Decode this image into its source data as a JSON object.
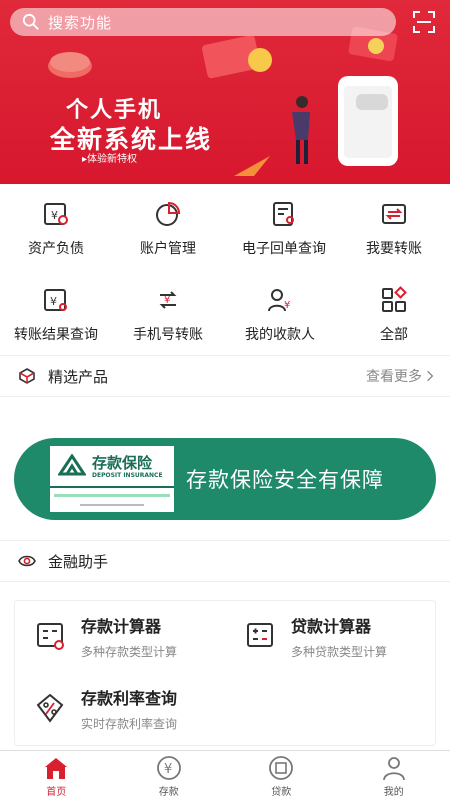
{
  "search": {
    "placeholder": "搜索功能"
  },
  "banner": {
    "line1": "个人手机",
    "line2": "全新系统上线",
    "tag": "▸体验新特权"
  },
  "quick_actions": [
    {
      "label": "资产负债",
      "icon": "asset-liability-icon"
    },
    {
      "label": "账户管理",
      "icon": "pie-chart-icon"
    },
    {
      "label": "电子回单查询",
      "icon": "receipt-search-icon"
    },
    {
      "label": "我要转账",
      "icon": "transfer-icon"
    },
    {
      "label": "转账结果查询",
      "icon": "transfer-result-icon"
    },
    {
      "label": "手机号转账",
      "icon": "phone-transfer-icon"
    },
    {
      "label": "我的收款人",
      "icon": "payee-icon"
    },
    {
      "label": "全部",
      "icon": "all-apps-icon"
    }
  ],
  "featured": {
    "title": "精选产品",
    "more": "查看更多"
  },
  "insurance": {
    "card_title": "存款保险",
    "card_subtitle": "DEPOSIT INSURANCE",
    "slogan": "存款保险安全有保障"
  },
  "assistant": {
    "title": "金融助手"
  },
  "tools": [
    {
      "title": "存款计算器",
      "subtitle": "多种存款类型计算",
      "icon": "calculator-icon"
    },
    {
      "title": "贷款计算器",
      "subtitle": "多种贷款类型计算",
      "icon": "calculator-icon"
    },
    {
      "title": "存款利率查询",
      "subtitle": "实时存款利率查询",
      "icon": "percent-icon"
    }
  ],
  "tabs": [
    {
      "label": "首页",
      "icon": "home-icon",
      "active": true
    },
    {
      "label": "存款",
      "icon": "yuan-circle-icon",
      "active": false
    },
    {
      "label": "贷款",
      "icon": "loan-circle-icon",
      "active": false
    },
    {
      "label": "我的",
      "icon": "user-icon",
      "active": false
    }
  ],
  "colors": {
    "brand_red": "#d8202f",
    "insurance_green": "#1f8a6a"
  }
}
